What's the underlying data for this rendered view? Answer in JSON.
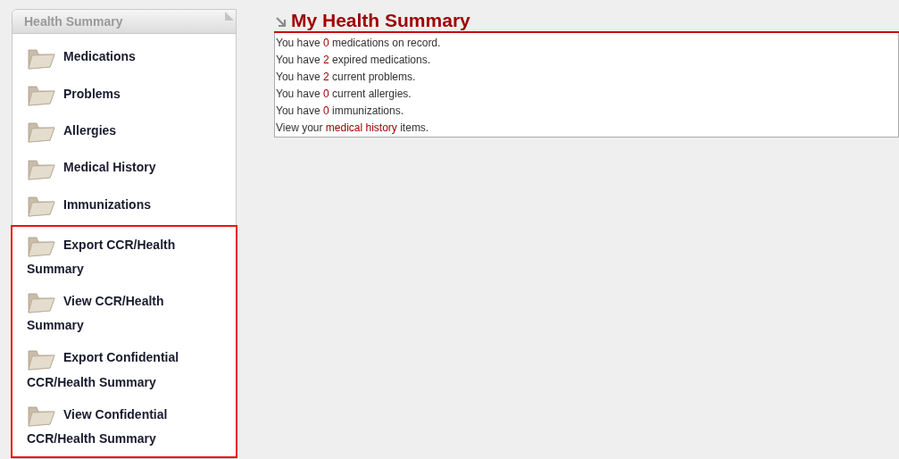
{
  "sidebar": {
    "title": "Health Summary",
    "items": [
      {
        "kind": "folder",
        "label": "Medications"
      },
      {
        "kind": "folder",
        "label": "Problems"
      },
      {
        "kind": "folder",
        "label": "Allergies"
      },
      {
        "kind": "folder",
        "label": "Medical History"
      },
      {
        "kind": "folder",
        "label": "Immunizations"
      }
    ],
    "highlighted_items": [
      {
        "kind": "folder",
        "label": "Export CCR/Health Summary"
      },
      {
        "kind": "folder",
        "label": "View CCR/Health Summary"
      },
      {
        "kind": "folder",
        "label": "Export Confidential CCR/Health Summary"
      },
      {
        "kind": "folder",
        "label": "View Confidential CCR/Health Summary"
      }
    ]
  },
  "main": {
    "title": "My Health Summary",
    "lines": [
      {
        "before": "You have",
        "link": "0",
        "after": "medications on record."
      },
      {
        "before": "You have",
        "link": "2",
        "after": "expired medications."
      },
      {
        "before": "You have",
        "link": "2",
        "after": "current problems."
      },
      {
        "before": "You have",
        "link": "0",
        "after": "current allergies."
      },
      {
        "before": "You have",
        "link": "0",
        "after": "immunizations."
      },
      {
        "before": "View your",
        "link": "medical history",
        "after": "items."
      }
    ]
  }
}
